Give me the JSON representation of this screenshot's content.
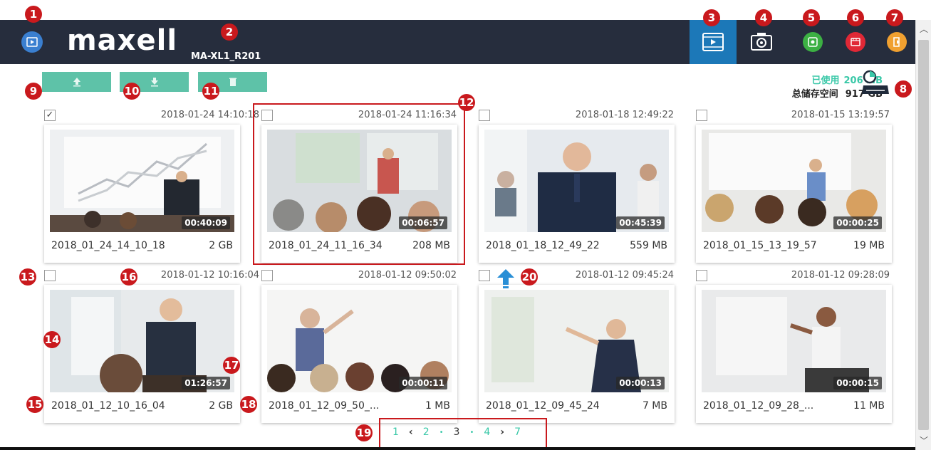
{
  "header": {
    "logo": "maxell",
    "device_name": "MA-XL1_R201"
  },
  "toolbar": {
    "buttons": [
      {
        "icon": "video-library-icon",
        "active": true
      },
      {
        "icon": "camera-icon",
        "active": false
      },
      {
        "icon": "settings-icon",
        "color": "#3cb043"
      },
      {
        "icon": "recorder-icon",
        "color": "#e02836"
      },
      {
        "icon": "logout-icon",
        "color": "#f0a030"
      }
    ]
  },
  "actions": {
    "upload": "upload-icon",
    "download": "download-icon",
    "delete": "trash-icon"
  },
  "storage": {
    "used_label": "已使用",
    "used_value": "206 MB",
    "total_label": "总储存空间",
    "total_value": "917 GB"
  },
  "recordings": [
    {
      "date": "2018-01-24  14:10:18",
      "name": "2018_01_24_14_10_18",
      "size": "2 GB",
      "duration": "00:40:09",
      "checked": true
    },
    {
      "date": "2018-01-24  11:16:34",
      "name": "2018_01_24_11_16_34",
      "size": "208 MB",
      "duration": "00:06:57",
      "checked": false
    },
    {
      "date": "2018-01-18  12:49:22",
      "name": "2018_01_18_12_49_22",
      "size": "559 MB",
      "duration": "00:45:39",
      "checked": false
    },
    {
      "date": "2018-01-15  13:19:57",
      "name": "2018_01_15_13_19_57",
      "size": "19 MB",
      "duration": "00:00:25",
      "checked": false
    },
    {
      "date": "2018-01-12  10:16:04",
      "name": "2018_01_12_10_16_04",
      "size": "2 GB",
      "duration": "01:26:57",
      "checked": false
    },
    {
      "date": "2018-01-12  09:50:02",
      "name": "2018_01_12_09_50_...",
      "size": "1 MB",
      "duration": "00:00:11",
      "checked": false
    },
    {
      "date": "2018-01-12  09:45:24",
      "name": "2018_01_12_09_45_24",
      "size": "7 MB",
      "duration": "00:00:13",
      "checked": false
    },
    {
      "date": "2018-01-12  09:28:09",
      "name": "2018_01_12_09_28_...",
      "size": "11 MB",
      "duration": "00:00:15",
      "checked": false
    }
  ],
  "pagination": {
    "first": "1",
    "pages": [
      "2",
      "3",
      "4"
    ],
    "current": "3",
    "last": "7"
  },
  "callouts": [
    "1",
    "2",
    "3",
    "4",
    "5",
    "6",
    "7",
    "8",
    "9",
    "10",
    "11",
    "12",
    "13",
    "14",
    "15",
    "16",
    "17",
    "18",
    "19",
    "20"
  ],
  "colors": {
    "topbar": "#262d3d",
    "accent": "#5ec2a8",
    "active_tab": "#1c78b8",
    "callout": "#c9191d"
  }
}
